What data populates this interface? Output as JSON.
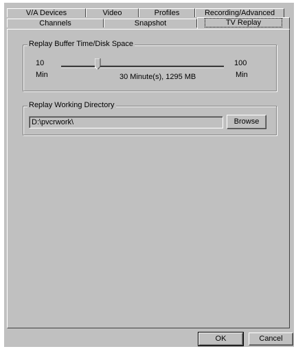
{
  "tabs": {
    "row1": [
      "V/A Devices",
      "Video",
      "Profiles",
      "Recording/Advanced"
    ],
    "row2": [
      "Channels",
      "Snapshot",
      "TV Replay"
    ],
    "selected": "TV Replay"
  },
  "replay_buffer": {
    "title": "Replay Buffer Time/Disk Space",
    "min_value": "10",
    "min_unit": "Min",
    "max_value": "100",
    "max_unit": "Min",
    "status": "30 Minute(s), 1295 MB",
    "slider_value": 30,
    "slider_min": 10,
    "slider_max": 100
  },
  "working_dir": {
    "title": "Replay Working Directory",
    "path": "D:\\pvcrwork\\",
    "browse_label": "Browse"
  },
  "footer": {
    "ok_label": "OK",
    "cancel_label": "Cancel"
  }
}
